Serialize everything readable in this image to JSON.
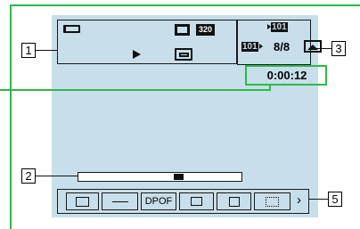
{
  "callouts": {
    "n1": "1",
    "n2": "2",
    "n3": "3",
    "n5": "5"
  },
  "indicators": {
    "battery_icon": "battery-icon",
    "film_icon": "film-icon",
    "image_size": "320",
    "playback_icon": "play-icon",
    "folder_icon": "folder-icon",
    "folder_top": "101",
    "folder_left": "101",
    "frame_count": "8/8",
    "memory_icon": "internal-memory-icon",
    "counter": "0:00:12"
  },
  "menu": {
    "buttons": [
      {
        "name": "folder",
        "label": ""
      },
      {
        "name": "protect",
        "label": ""
      },
      {
        "name": "dpof",
        "label": "DPOF"
      },
      {
        "name": "print",
        "label": ""
      },
      {
        "name": "slideshow",
        "label": ""
      },
      {
        "name": "resize",
        "label": ""
      }
    ],
    "more_arrow": "›"
  },
  "playback_bar": {
    "position": 0.62
  },
  "colors": {
    "screen": "#c7dfea",
    "highlight": "#2eb84a",
    "outline": "#1a1a1a"
  }
}
